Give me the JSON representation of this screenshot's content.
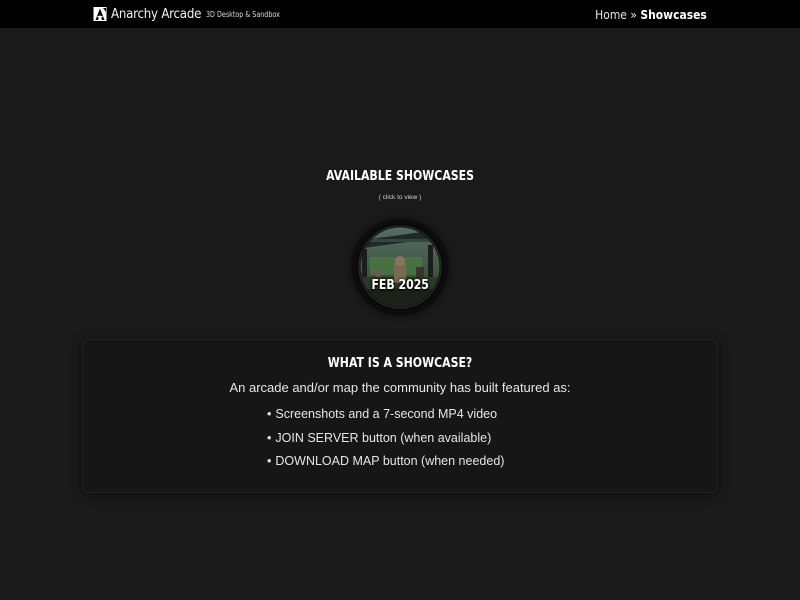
{
  "header": {
    "brand_name": "Anarchy Arcade",
    "tagline": "3D Desktop & Sandbox",
    "logo_icon": "anarchy-arcade-logo-icon",
    "breadcrumb": {
      "home": "Home",
      "separator": "»",
      "current": "Showcases"
    }
  },
  "showcases": {
    "title": "AVAILABLE SHOWCASES",
    "hint": "( click to view )",
    "items": [
      {
        "label": "FEB 2025"
      }
    ]
  },
  "info_card": {
    "title": "WHAT IS A SHOWCASE?",
    "description": "An arcade and/or map the community has built featured as:",
    "features": [
      "Screenshots and a 7-second MP4 video",
      "JOIN SERVER button (when available)",
      "DOWNLOAD MAP button (when needed)"
    ]
  },
  "colors": {
    "page_background": "#1a1a1a",
    "topbar_background": "#000000",
    "card_background": "#161616",
    "text": "#e8e8e8"
  }
}
